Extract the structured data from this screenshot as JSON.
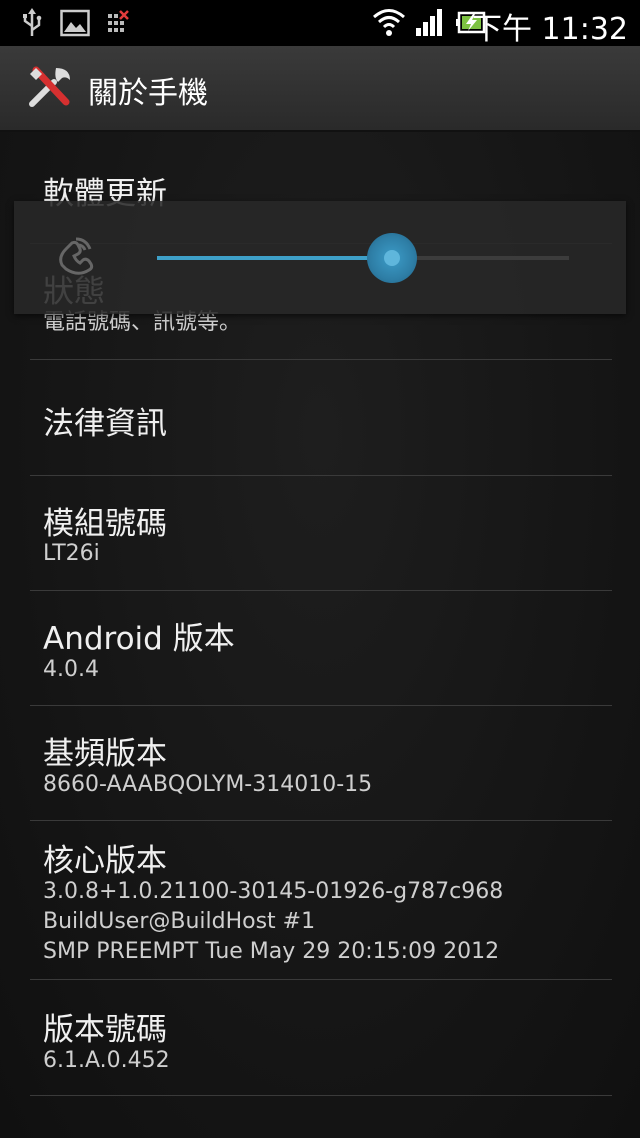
{
  "status_bar": {
    "time": "下午 11:32",
    "icons": [
      "usb-icon",
      "image-icon",
      "signal-x-icon",
      "wifi-icon",
      "cell-signal-icon",
      "battery-charging-icon"
    ]
  },
  "action_bar": {
    "title": "關於手機",
    "icon": "tools-icon"
  },
  "volume_overlay": {
    "icon": "ringtone-volume-icon",
    "level_fraction": 0.57
  },
  "settings": {
    "items": [
      {
        "label": "軟體更新",
        "summary": ""
      },
      {
        "label": "狀態",
        "summary": "電話號碼、訊號等。"
      },
      {
        "label": "法律資訊",
        "summary": ""
      },
      {
        "label": "模組號碼",
        "summary": "LT26i"
      },
      {
        "label": "Android 版本",
        "summary": "4.0.4"
      },
      {
        "label": "基頻版本",
        "summary": "8660-AAABQOLYM-314010-15"
      },
      {
        "label": "核心版本",
        "summary_lines": [
          "3.0.8+1.0.21100-30145-01926-g787c968",
          "BuildUser@BuildHost #1",
          "SMP PREEMPT Tue May 29 20:15:09 2012"
        ]
      },
      {
        "label": "版本號碼",
        "summary": "6.1.A.0.452"
      }
    ]
  },
  "colors": {
    "accent": "#3ea0c8",
    "background": "#161616",
    "status_bar": "#000000"
  }
}
